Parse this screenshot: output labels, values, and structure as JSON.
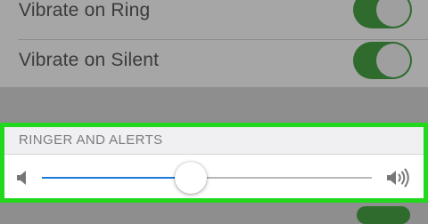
{
  "settings": {
    "rows": [
      {
        "label": "Vibrate on Ring",
        "enabled": true
      },
      {
        "label": "Vibrate on Silent",
        "enabled": true
      }
    ]
  },
  "ringer": {
    "header": "RINGER AND ALERTS",
    "volume_fraction": 0.45,
    "low_icon": "speaker-low-icon",
    "high_icon": "speaker-high-icon",
    "highlight_color": "#22d81d",
    "track_fill_color": "#1a7bdc"
  },
  "colors": {
    "toggle_on": "#2e6b2c"
  }
}
